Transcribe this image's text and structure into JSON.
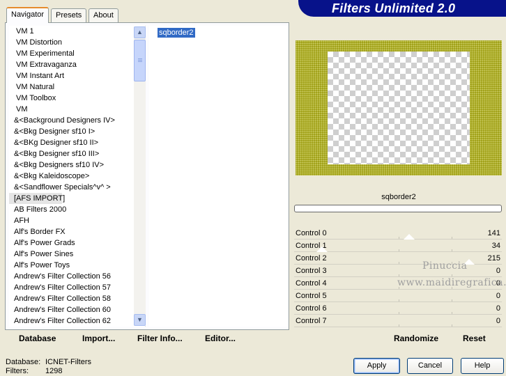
{
  "tabs": [
    {
      "label": "Navigator",
      "active": true
    },
    {
      "label": "Presets",
      "active": false
    },
    {
      "label": "About",
      "active": false
    }
  ],
  "banner": {
    "title": "Filters Unlimited 2.0"
  },
  "categories": [
    "VM 1",
    "VM Distortion",
    "VM Experimental",
    "VM Extravaganza",
    "VM Instant Art",
    "VM Natural",
    "VM Toolbox",
    "VM",
    "&<Background Designers IV>",
    "&<Bkg Designer sf10 I>",
    "&<BKg Designer sf10 II>",
    "&<Bkg Designer sf10 III>",
    "&<Bkg Designers sf10 IV>",
    "&<Bkg Kaleidoscope>",
    "&<Sandflower Specials^v^ >",
    "[AFS IMPORT]",
    "AB Filters 2000",
    "AFH",
    "Alf's Border FX",
    "Alf's Power Grads",
    "Alf's Power Sines",
    "Alf's Power Toys",
    "Andrew's Filter Collection 56",
    "Andrew's Filter Collection 57",
    "Andrew's Filter Collection 58",
    "Andrew's Filter Collection 60",
    "Andrew's Filter Collection 62"
  ],
  "selected_category": "[AFS IMPORT]",
  "filters": [
    "sqborder2"
  ],
  "selected_filter": "sqborder2",
  "scroll_icons": {
    "up": "chevron-up-icon",
    "down": "chevron-down-icon"
  },
  "bottom_left_buttons": {
    "database": "Database",
    "import": "Import...",
    "filter_info": "Filter Info...",
    "editor": "Editor..."
  },
  "preview": {
    "filter_name": "sqborder2",
    "border_color": "#9e9e12"
  },
  "controls": [
    {
      "label": "Control 0",
      "value": "141",
      "level": 141
    },
    {
      "label": "Control 1",
      "value": "34",
      "level": 34
    },
    {
      "label": "Control 2",
      "value": "215",
      "level": 215
    },
    {
      "label": "Control 3",
      "value": "0",
      "level": 0
    },
    {
      "label": "Control 4",
      "value": "0",
      "level": 0
    },
    {
      "label": "Control 5",
      "value": "0",
      "level": 0
    },
    {
      "label": "Control 6",
      "value": "0",
      "level": 0
    },
    {
      "label": "Control 7",
      "value": "0",
      "level": 0
    }
  ],
  "control_max": 255,
  "watermark": {
    "line1": "Pinuccia",
    "line2": "www.maidiregrafica.eu"
  },
  "right_buttons": {
    "randomize": "Randomize",
    "reset": "Reset"
  },
  "status": {
    "database_label": "Database:",
    "database_value": "ICNET-Filters",
    "filters_label": "Filters:",
    "filters_value": "1298"
  },
  "dialog_buttons": {
    "apply": "Apply",
    "cancel": "Cancel",
    "help": "Help"
  }
}
